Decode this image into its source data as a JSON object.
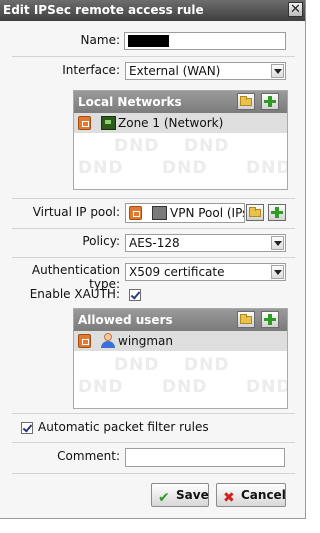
{
  "dialog": {
    "title": "Edit IPSec remote access rule",
    "close_glyph": "✕"
  },
  "form": {
    "name_label": "Name:",
    "name_value": "",
    "interface_label": "Interface:",
    "interface_value": "External (WAN)",
    "virtual_ip_label": "Virtual IP pool:",
    "virtual_ip_value": "VPN Pool (IPs",
    "policy_label": "Policy:",
    "policy_value": "AES-128",
    "auth_type_label": "Authentication type:",
    "auth_type_value": "X509 certificate",
    "xauth_label": "Enable XAUTH:",
    "xauth_checked": true,
    "packet_filter_label": "Automatic packet filter rules",
    "packet_filter_checked": true,
    "comment_label": "Comment:",
    "comment_value": ""
  },
  "local_networks": {
    "title": "Local Networks",
    "items": [
      {
        "label": "Zone 1 (Network)",
        "icon": "network-icon"
      }
    ],
    "watermark": "DND"
  },
  "allowed_users": {
    "title": "Allowed users",
    "items": [
      {
        "label": "wingman",
        "icon": "user-icon"
      }
    ],
    "watermark": "DND"
  },
  "buttons": {
    "save_label": "Save",
    "cancel_label": "Cancel",
    "save_glyph": "✔",
    "cancel_glyph": "✖"
  },
  "colors": {
    "title_bar": "#4f4f4f",
    "panel_header": "#8a8a8a",
    "save_icon": "#2f9a24",
    "cancel_icon": "#d62020"
  }
}
